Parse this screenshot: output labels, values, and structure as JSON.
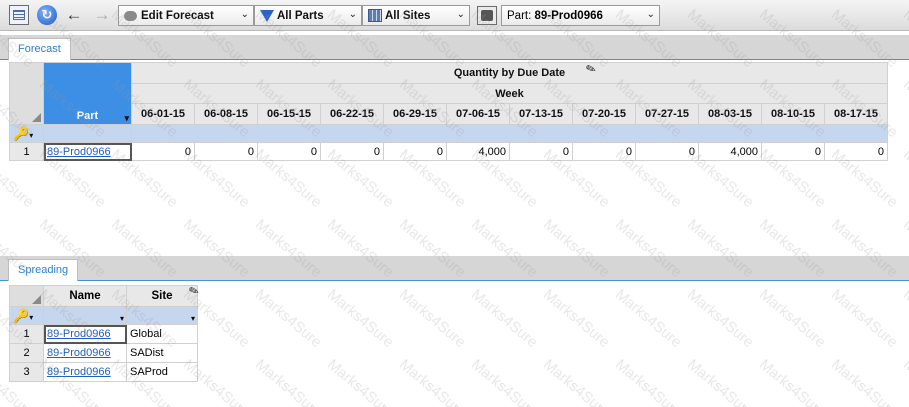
{
  "toolbar": {
    "edit_forecast_label": "Edit Forecast",
    "parts_filter_label": "All Parts",
    "sites_filter_label": "All Sites",
    "part_prefix": "Part: ",
    "part_value": "89-Prod0966"
  },
  "forecast_tab": {
    "label": "Forecast"
  },
  "forecast_grid": {
    "group_header": "Quantity by Due Date",
    "sub_header": "Week",
    "part_column": "Part",
    "weeks": [
      "06-01-15",
      "06-08-15",
      "06-15-15",
      "06-22-15",
      "06-29-15",
      "07-06-15",
      "07-13-15",
      "07-20-15",
      "07-27-15",
      "08-03-15",
      "08-10-15",
      "08-17-15"
    ],
    "rows": [
      {
        "num": "1",
        "part": "89-Prod0966",
        "values": [
          "0",
          "0",
          "0",
          "0",
          "0",
          "4,000",
          "0",
          "0",
          "0",
          "4,000",
          "0",
          "0"
        ]
      }
    ]
  },
  "spreading_tab": {
    "label": "Spreading"
  },
  "spreading_grid": {
    "columns": [
      "Name",
      "Site"
    ],
    "rows": [
      {
        "num": "1",
        "name": "89-Prod0966",
        "site": "Global"
      },
      {
        "num": "2",
        "name": "89-Prod0966",
        "site": "SADist"
      },
      {
        "num": "3",
        "name": "89-Prod0966",
        "site": "SAProd"
      }
    ]
  },
  "icons": [
    "grid-view-icon",
    "refresh-icon",
    "back-arrow-icon",
    "forward-arrow-icon",
    "chat-bubble-icon",
    "filter-funnel-icon",
    "building-icon",
    "part-icon",
    "pencil-icon",
    "search-key-icon",
    "chevron-down-icon"
  ],
  "colors": {
    "header_blue": "#3d8fe6",
    "filter_row": "#c5d7ee",
    "tab_text": "#2b7fd4",
    "link": "#1f5fbf"
  }
}
